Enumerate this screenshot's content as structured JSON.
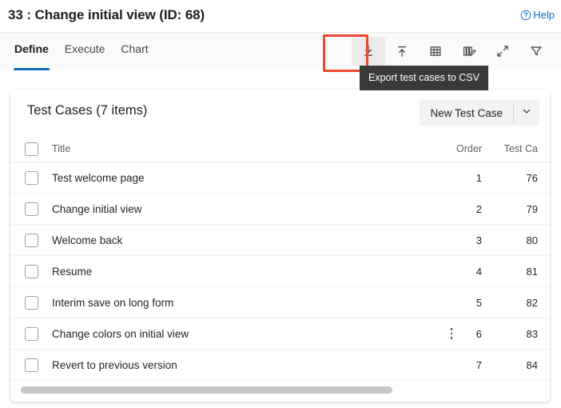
{
  "header": {
    "title": "33 : Change initial view (ID: 68)",
    "help_label": "Help",
    "help_icon": "question-circle-icon"
  },
  "command_bar": {
    "tabs": [
      {
        "label": "Define",
        "active": true
      },
      {
        "label": "Execute",
        "active": false
      },
      {
        "label": "Chart",
        "active": false
      }
    ],
    "tools": [
      {
        "name": "export-csv-icon",
        "icon": "download-to-line",
        "highlighted": true,
        "hover": true
      },
      {
        "name": "import-csv-icon",
        "icon": "upload-to-line",
        "highlighted": false,
        "hover": false
      },
      {
        "name": "grid-view-icon",
        "icon": "table-grid",
        "highlighted": false,
        "hover": false
      },
      {
        "name": "edit-columns-icon",
        "icon": "columns-pencil",
        "highlighted": false,
        "hover": false
      },
      {
        "name": "expand-icon",
        "icon": "diagonal-arrows",
        "highlighted": false,
        "hover": false
      },
      {
        "name": "filter-icon",
        "icon": "funnel",
        "highlighted": false,
        "hover": false
      }
    ],
    "tooltip": {
      "text": "Export test cases to CSV",
      "for": "export-csv-icon"
    },
    "accent_color": "#0f6cbd",
    "highlight_color": "#eb4b35"
  },
  "card": {
    "title": "Test Cases (7 items)",
    "item_count": 7,
    "new_button": {
      "label": "New Test Case",
      "caret_icon": "chevron-down-icon"
    },
    "table": {
      "columns": [
        {
          "key": "select",
          "header": ""
        },
        {
          "key": "title",
          "header": "Title"
        },
        {
          "key": "order",
          "header": "Order"
        },
        {
          "key": "test_case_id",
          "header": "Test Ca"
        }
      ],
      "select_all_checked": false,
      "rows": [
        {
          "checked": false,
          "title": "Test welcome page",
          "order": "1",
          "test_case_id": "76",
          "show_more": false
        },
        {
          "checked": false,
          "title": "Change initial view",
          "order": "2",
          "test_case_id": "79",
          "show_more": false
        },
        {
          "checked": false,
          "title": "Welcome back",
          "order": "3",
          "test_case_id": "80",
          "show_more": false
        },
        {
          "checked": false,
          "title": "Resume",
          "order": "4",
          "test_case_id": "81",
          "show_more": false
        },
        {
          "checked": false,
          "title": "Interim save on long form",
          "order": "5",
          "test_case_id": "82",
          "show_more": false
        },
        {
          "checked": false,
          "title": "Change colors on initial view",
          "order": "6",
          "test_case_id": "83",
          "show_more": true
        },
        {
          "checked": false,
          "title": "Revert to previous version",
          "order": "7",
          "test_case_id": "84",
          "show_more": false
        }
      ]
    },
    "scrollbar": {
      "orientation": "horizontal",
      "thumb_fraction": 0.69
    }
  }
}
